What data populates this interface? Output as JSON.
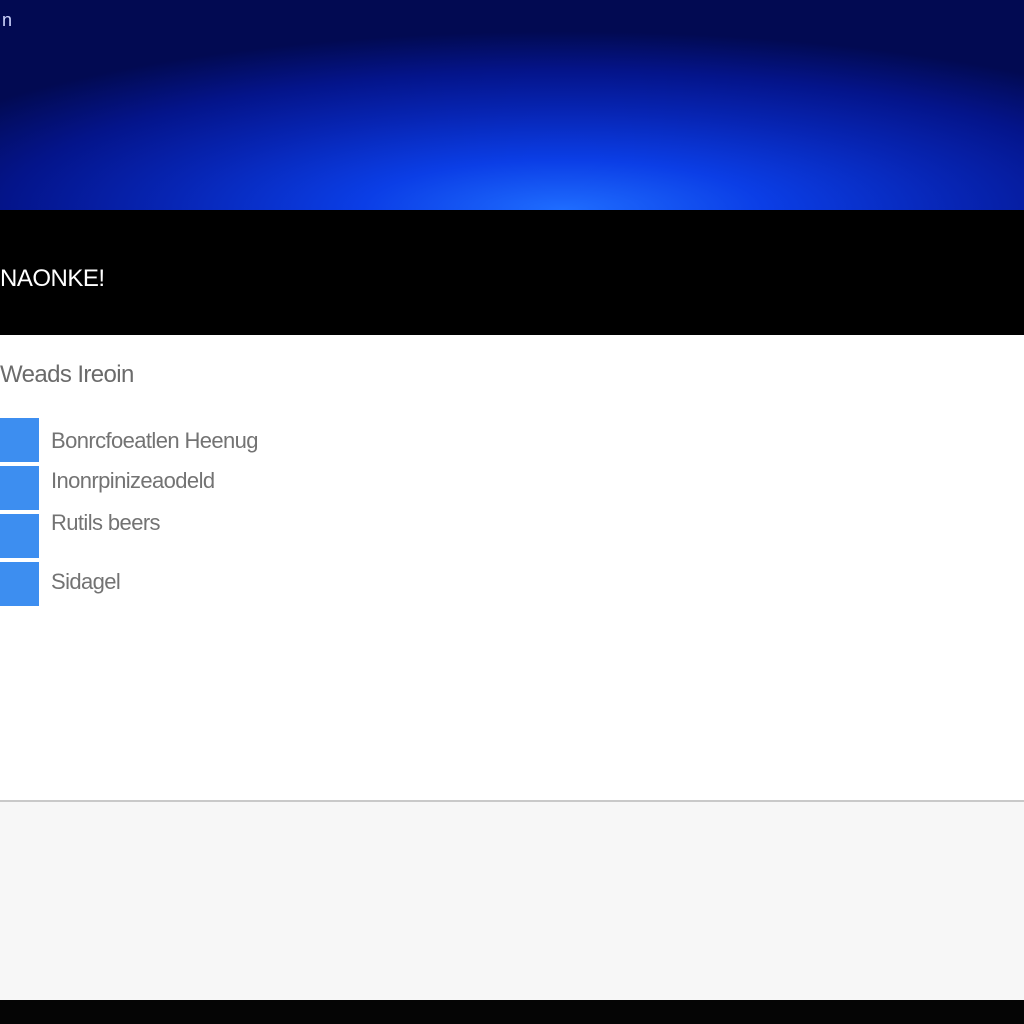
{
  "hero": {
    "corner_text": "n"
  },
  "title_bar": {
    "title": "NAONKE!"
  },
  "content": {
    "heading": "Weads Ireoin",
    "menu_items": [
      {
        "label": "Bonrcfoeatlen Heenug"
      },
      {
        "label": "Inonrpinizeaodeld"
      },
      {
        "label": "Rutils beers"
      },
      {
        "label": "Sidagel"
      }
    ]
  },
  "colors": {
    "hero_blue": "#0b3ee6",
    "title_bar_bg": "#000000",
    "panel_bg": "#ffffff",
    "menu_square": "#3d8ef0",
    "text_gray": "#737373"
  }
}
